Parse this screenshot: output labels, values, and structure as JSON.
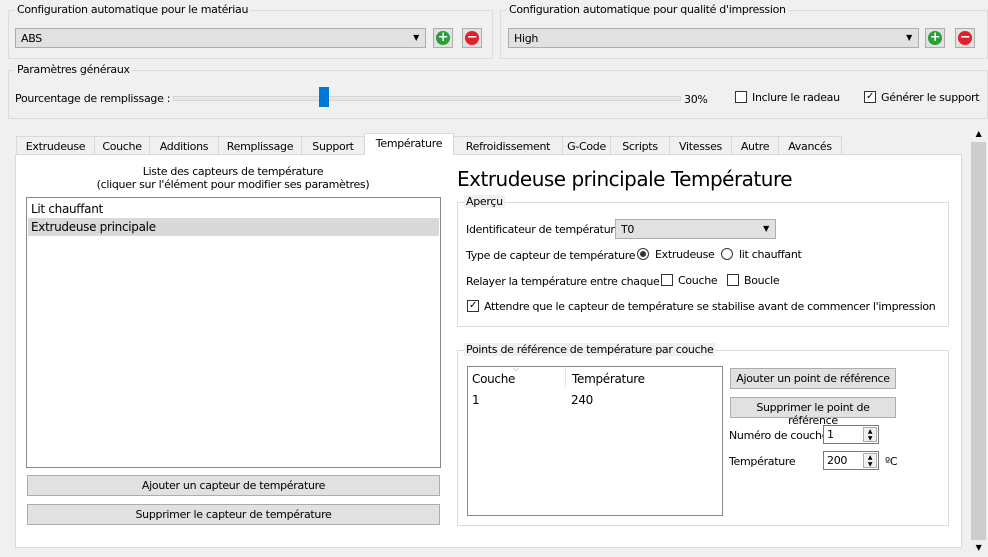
{
  "material": {
    "legend": "Configuration automatique pour le matériau",
    "value": "ABS"
  },
  "quality": {
    "legend": "Configuration automatique pour qualité d'impression",
    "value": "High"
  },
  "general": {
    "legend": "Paramètres généraux",
    "infill_label": "Pourcentage de remplissage :",
    "infill_value": "30%",
    "infill_percent": 30,
    "raft_label": "Inclure le radeau",
    "raft_checked": false,
    "support_label": "Générer le support",
    "support_checked": true
  },
  "tabs": [
    "Extrudeuse",
    "Couche",
    "Additions",
    "Remplissage",
    "Support",
    "Température",
    "Refroidissement",
    "G-Code",
    "Scripts",
    "Vitesses",
    "Autre",
    "Avancés"
  ],
  "active_tab": "Température",
  "sensors": {
    "title1": "Liste des capteurs de température",
    "title2": "(cliquer sur l'élément pour modifier ses paramètres)",
    "items": [
      "Lit chauffant",
      "Extrudeuse principale"
    ],
    "selected": "Extrudeuse principale",
    "add_label": "Ajouter un capteur de température",
    "remove_label": "Supprimer le capteur de température"
  },
  "detail": {
    "title": "Extrudeuse principale Température",
    "overview": {
      "legend": "Aperçu",
      "id_label": "Identificateur de température",
      "id_value": "T0",
      "type_label": "Type de capteur de température :",
      "type_opt1": "Extrudeuse",
      "type_opt2": "lit chauffant",
      "relay_label": "Relayer la température entre chaque :",
      "relay_opt1": "Couche",
      "relay_opt2": "Boucle",
      "wait_label": "Attendre que le capteur de température se stabilise avant de commencer l'impression",
      "wait_checked": true
    },
    "points": {
      "legend": "Points de référence de température par couche",
      "columns": [
        "Couche",
        "Température"
      ],
      "rows": [
        [
          "1",
          "240"
        ]
      ],
      "add_label": "Ajouter un point de référence",
      "remove_label": "Supprimer le point de référence",
      "layer_label": "Numéro de couche",
      "layer_value": "1",
      "temp_label": "Température",
      "temp_value": "200",
      "unit": "ºC"
    }
  }
}
